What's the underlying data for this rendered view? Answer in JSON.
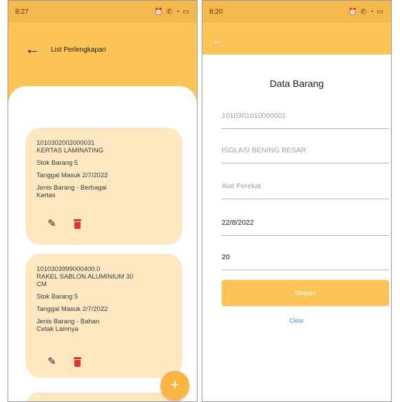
{
  "left": {
    "status": {
      "time": "8:27",
      "icons": "⏰ ✆ ◔ ▭"
    },
    "appbar": {
      "title": "List Perlengkapan"
    },
    "cards": [
      {
        "code": "1010302002000031",
        "name": "KERTAS LAMINATING",
        "stock": "Stok Barang 5",
        "date": "Tanggal Masuk 2/7/2022",
        "type_l1": "Jenis Barang - Berbagai",
        "type_l2": "Kertas"
      },
      {
        "code": "1010303999000400.0",
        "name_l1": "RAKEL SABLON ALUMINIUM 30",
        "name_l2": "CM",
        "stock": "Stok Barang 5",
        "date": "Tanggal Masuk 2/7/2022",
        "type_l1": "Jenis Barang - Bahan",
        "type_l2": "Cetak Lainnya"
      }
    ],
    "fab_label": "+"
  },
  "right": {
    "status": {
      "time": "8:20",
      "icons": "⏰ ✆ ◔ ▭"
    },
    "heading": "Data Barang",
    "fields": {
      "code_placeholder": "1010301010000001",
      "name_placeholder": "ISOLASI BENING BESAR",
      "type_placeholder": "Alat Perekat",
      "date_value": "22/8/2022",
      "qty_value": "20"
    },
    "save_label": "Simpan",
    "clear_label": "Clear"
  },
  "colors": {
    "accent": "#fcc457",
    "card": "#fde8c2",
    "delete": "#e8332a",
    "link": "#4a90d9"
  }
}
